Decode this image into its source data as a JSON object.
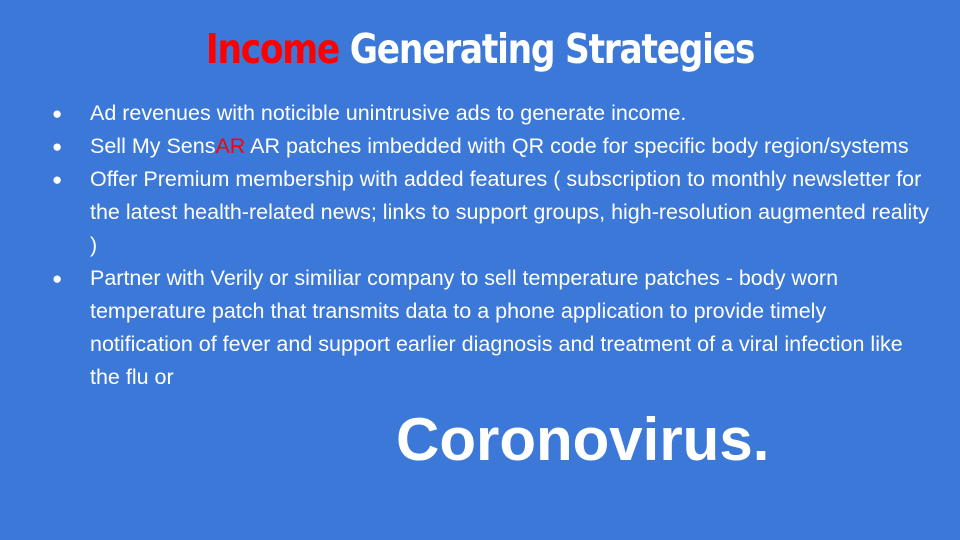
{
  "title": {
    "accent": "Income",
    "rest": " Generating Strategies"
  },
  "bullet_glyph": "●",
  "bullets": [
    {
      "text": "Ad revenues with noticible unintrusive ads to generate income."
    },
    {
      "prefix": "Sell My Sens",
      "highlight": "AR",
      "suffix": " AR patches imbedded with QR code for specific body region/systems"
    },
    {
      "text": "Offer Premium membership with added features ( subscription to monthly newsletter for the latest health-related news; links to support groups, high-resolution augmented reality )"
    },
    {
      "text": "Partner with Verily or similiar company to sell temperature patches - body worn temperature patch that transmits data to a phone application to provide timely notification of fever and support earlier diagnosis and treatment of a viral infection like the flu or"
    }
  ],
  "emphasis_word": "Coronovirus.",
  "colors": {
    "background": "#3b78d8",
    "text": "#ffffff",
    "accent": "#ff0000"
  }
}
